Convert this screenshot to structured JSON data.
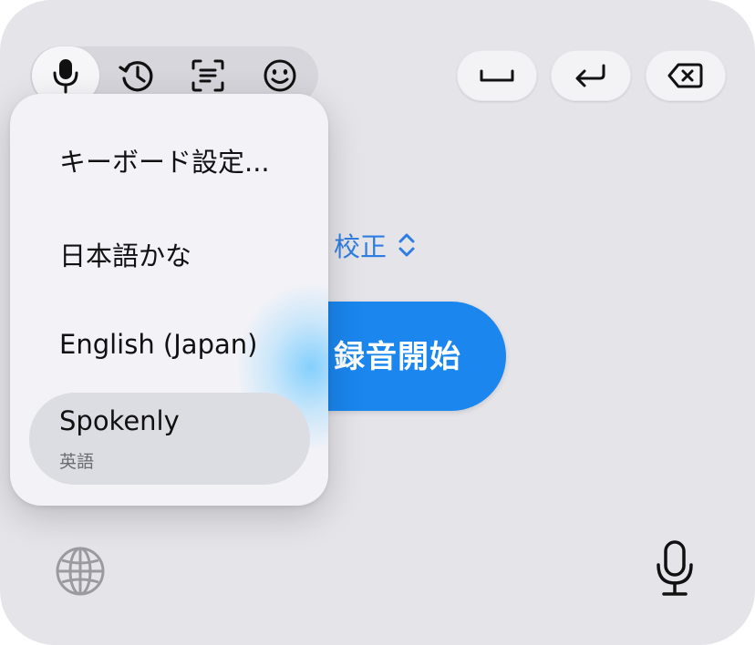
{
  "toolbar": {
    "modes": [
      {
        "icon": "microphone-icon",
        "active": true
      },
      {
        "icon": "history-icon",
        "active": false
      },
      {
        "icon": "text-scan-icon",
        "active": false
      },
      {
        "icon": "emoji-icon",
        "active": false
      }
    ],
    "keys": [
      {
        "icon": "space-icon"
      },
      {
        "icon": "return-icon"
      },
      {
        "icon": "delete-icon"
      }
    ]
  },
  "correction": {
    "label": "校正",
    "icon": "up-down-chevron-icon"
  },
  "record": {
    "label": "録音開始"
  },
  "menu": {
    "items": [
      {
        "label": "キーボード設定...",
        "subtitle": ""
      },
      {
        "label": "日本語かな",
        "subtitle": ""
      },
      {
        "label": "English (Japan)",
        "subtitle": ""
      },
      {
        "label": "Spokenly",
        "subtitle": "英語",
        "selected": true
      }
    ]
  },
  "bottom": {
    "left_icon": "globe-icon",
    "right_icon": "microphone-icon"
  },
  "colors": {
    "keyboard_bg": "#e4e4e9",
    "accent": "#1a86ee",
    "link": "#2f7de2"
  }
}
